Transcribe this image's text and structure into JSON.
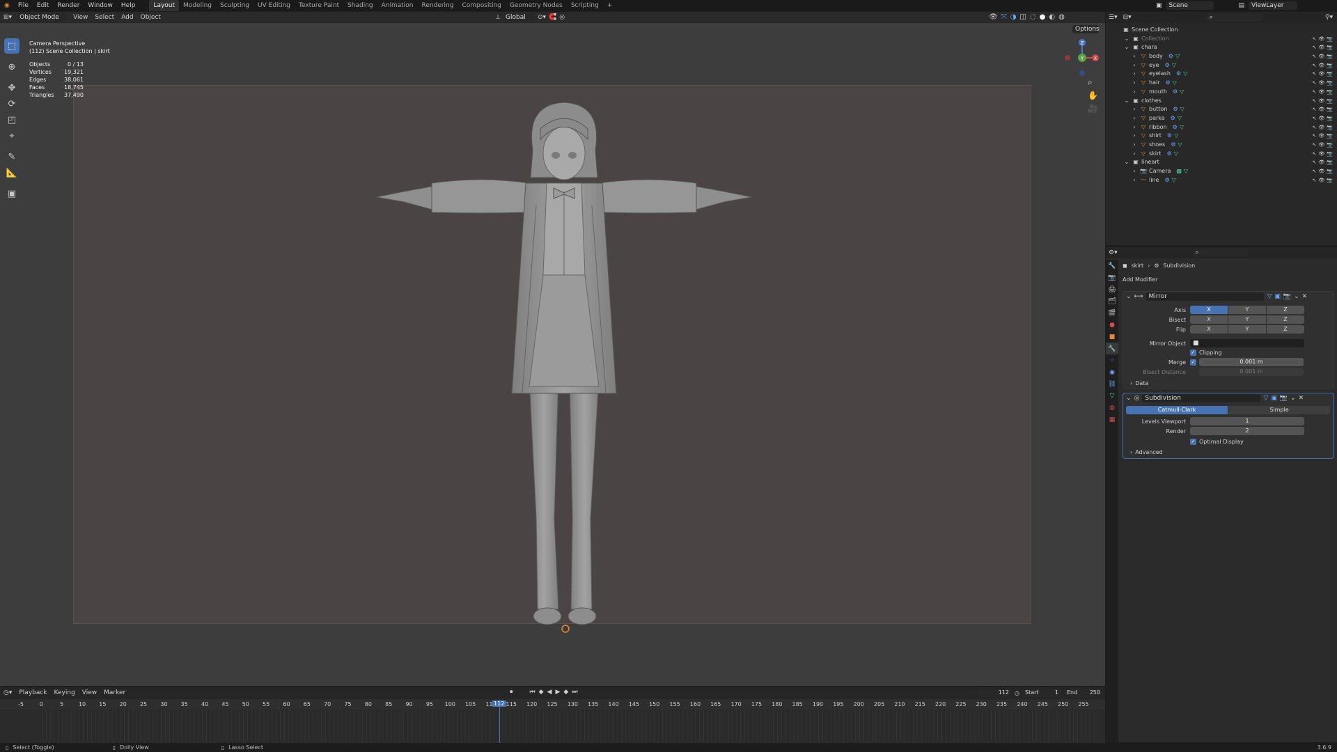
{
  "topbar": {
    "menus": [
      "File",
      "Edit",
      "Render",
      "Window",
      "Help"
    ],
    "workspaces": [
      "Layout",
      "Modeling",
      "Sculpting",
      "UV Editing",
      "Texture Paint",
      "Shading",
      "Animation",
      "Rendering",
      "Compositing",
      "Geometry Nodes",
      "Scripting"
    ],
    "active_workspace": "Layout",
    "add_tab": "+",
    "scene": "Scene",
    "view_layer": "ViewLayer"
  },
  "viewport": {
    "mode": "Object Mode",
    "menus": [
      "View",
      "Select",
      "Add",
      "Object"
    ],
    "orientation": "Global",
    "options": "Options",
    "camera_label": "Camera Perspective",
    "collection_label": "(112) Scene Collection | skirt",
    "stats": [
      {
        "label": "Objects",
        "value": "0 / 13"
      },
      {
        "label": "Vertices",
        "value": "19,321"
      },
      {
        "label": "Edges",
        "value": "38,061"
      },
      {
        "label": "Faces",
        "value": "18,745"
      },
      {
        "label": "Triangles",
        "value": "37,490"
      }
    ],
    "gizmo_axes": [
      "Z",
      "X",
      "Y"
    ]
  },
  "outliner": {
    "root": "Scene Collection",
    "rows": [
      {
        "name": "Collection",
        "depth": 1,
        "type": "collection",
        "dim": true
      },
      {
        "name": "chara",
        "depth": 1,
        "type": "collection"
      },
      {
        "name": "body",
        "depth": 2,
        "type": "mesh"
      },
      {
        "name": "eye",
        "depth": 2,
        "type": "mesh"
      },
      {
        "name": "eyelash",
        "depth": 2,
        "type": "mesh"
      },
      {
        "name": "hair",
        "depth": 2,
        "type": "mesh"
      },
      {
        "name": "mouth",
        "depth": 2,
        "type": "mesh"
      },
      {
        "name": "clothes",
        "depth": 1,
        "type": "collection"
      },
      {
        "name": "button",
        "depth": 2,
        "type": "mesh"
      },
      {
        "name": "parka",
        "depth": 2,
        "type": "mesh"
      },
      {
        "name": "ribbon",
        "depth": 2,
        "type": "mesh"
      },
      {
        "name": "shirt",
        "depth": 2,
        "type": "mesh"
      },
      {
        "name": "shoes",
        "depth": 2,
        "type": "mesh"
      },
      {
        "name": "skirt",
        "depth": 2,
        "type": "mesh"
      },
      {
        "name": "lineart",
        "depth": 1,
        "type": "collection"
      },
      {
        "name": "Camera",
        "depth": 2,
        "type": "camera"
      },
      {
        "name": "line",
        "depth": 2,
        "type": "gpencil"
      }
    ]
  },
  "properties": {
    "breadcrumb_object": "skirt",
    "breadcrumb_modifier": "Subdivision",
    "add_modifier": "Add Modifier",
    "mirror": {
      "name": "Mirror",
      "axis_label": "Axis",
      "bisect_label": "Bisect",
      "flip_label": "Flip",
      "axes": [
        "X",
        "Y",
        "Z"
      ],
      "mirror_object_label": "Mirror Object",
      "clipping_label": "Clipping",
      "merge_label": "Merge",
      "merge_value": "0.001 m",
      "bisect_distance_label": "Bisect Distance",
      "bisect_distance_value": "0.001 m",
      "data_label": "Data"
    },
    "subdivision": {
      "name": "Subdivision",
      "catmull": "Catmull-Clark",
      "simple": "Simple",
      "levels_viewport_label": "Levels Viewport",
      "levels_viewport": "1",
      "render_label": "Render",
      "render": "2",
      "optimal_display": "Optimal Display",
      "advanced": "Advanced"
    }
  },
  "timeline": {
    "menus": [
      "Playback",
      "Keying",
      "View",
      "Marker"
    ],
    "current_frame": "112",
    "start_label": "Start",
    "start": "1",
    "end_label": "End",
    "end": "250",
    "ticks": [
      "-5",
      "0",
      "5",
      "10",
      "15",
      "20",
      "25",
      "30",
      "35",
      "40",
      "45",
      "50",
      "55",
      "60",
      "65",
      "70",
      "75",
      "80",
      "85",
      "90",
      "95",
      "100",
      "105",
      "110",
      "115",
      "120",
      "125",
      "130",
      "135",
      "140",
      "145",
      "150",
      "155",
      "160",
      "165",
      "170",
      "175",
      "180",
      "185",
      "190",
      "195",
      "200",
      "205",
      "210",
      "215",
      "220",
      "225",
      "230",
      "235",
      "240",
      "245",
      "250",
      "255"
    ]
  },
  "status": {
    "select": "Select (Toggle)",
    "dolly": "Dolly View",
    "lasso": "Lasso Select",
    "version": "3.6.9"
  }
}
